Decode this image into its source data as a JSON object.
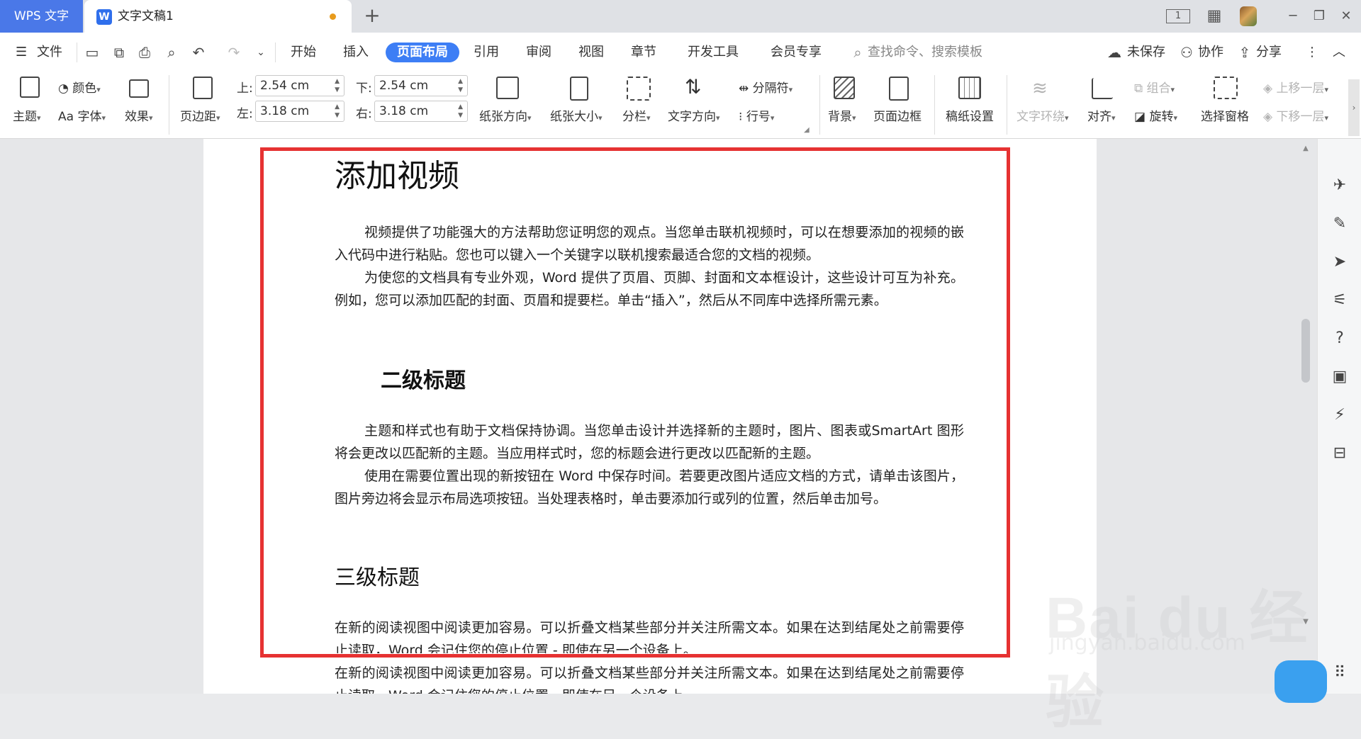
{
  "titlebar": {
    "app_tab": "WPS 文字",
    "doc_tab": "文字文稿1",
    "new_tab": "+",
    "page_indicator": "1",
    "grid": "▦",
    "minimize": "─",
    "restore": "❐",
    "close": "✕"
  },
  "menu": {
    "file": "文件",
    "tabs": [
      "开始",
      "插入",
      "页面布局",
      "引用",
      "审阅",
      "视图",
      "章节",
      "开发工具",
      "会员专享"
    ],
    "search_hint": "查找命令、搜索模板",
    "unsaved": "未保存",
    "collab": "协作",
    "share": "分享",
    "more": "⋮",
    "collapse": "︿"
  },
  "ribbon": {
    "theme": "主题",
    "colors": "颜色",
    "fonts": "字体",
    "effects": "效果",
    "margins": "页边距",
    "top_label": "上:",
    "top_value": "2.54 cm",
    "bottom_label": "下:",
    "bottom_value": "2.54 cm",
    "left_label": "左:",
    "left_value": "3.18 cm",
    "right_label": "右:",
    "right_value": "3.18 cm",
    "orientation": "纸张方向",
    "size": "纸张大小",
    "columns": "分栏",
    "text_direction": "文字方向",
    "breaks": "分隔符",
    "line_numbers": "行号",
    "background": "背景",
    "page_border": "页面边框",
    "grid_paper": "稿纸设置",
    "text_wrap": "文字环绕",
    "align": "对齐",
    "group": "组合",
    "rotate": "旋转",
    "selection_pane": "选择窗格",
    "bring_forward": "上移一层",
    "send_backward": "下移一层"
  },
  "document": {
    "h1": "添加视频",
    "p1": "视频提供了功能强大的方法帮助您证明您的观点。当您单击联机视频时，可以在想要添加的视频的嵌入代码中进行粘贴。您也可以键入一个关键字以联机搜索最适合您的文档的视频。",
    "p2": "为使您的文档具有专业外观，Word 提供了页眉、页脚、封面和文本框设计，这些设计可互为补充。例如，您可以添加匹配的封面、页眉和提要栏。单击“插入”，然后从不同库中选择所需元素。",
    "h2": "二级标题",
    "p3": "主题和样式也有助于文档保持协调。当您单击设计并选择新的主题时，图片、图表或SmartArt 图形将会更改以匹配新的主题。当应用样式时，您的标题会进行更改以匹配新的主题。",
    "p4": "使用在需要位置出现的新按钮在 Word 中保存时间。若要更改图片适应文档的方式，请单击该图片，图片旁边将会显示布局选项按钮。当处理表格时，单击要添加行或列的位置，然后单击加号。",
    "h3": "三级标题",
    "p5": "在新的阅读视图中阅读更加容易。可以折叠文档某些部分并关注所需文本。如果在达到结尾处之前需要停止读取，Word 会记住您的停止位置 - 即使在另一个设备上。",
    "p6": "在新的阅读视图中阅读更加容易。可以折叠文档某些部分并关注所需文本。如果在达到结尾处之前需要停止读取，Word 会记住您的停止位置 - 即使在另一个设备上。"
  },
  "watermark": {
    "brand": "Bai du 经验",
    "url": "jingyan.baidu.com"
  },
  "colors": {
    "accent": "#3d7ef5",
    "highlight_box": "#e63232",
    "app_tab": "#4a78e8"
  }
}
